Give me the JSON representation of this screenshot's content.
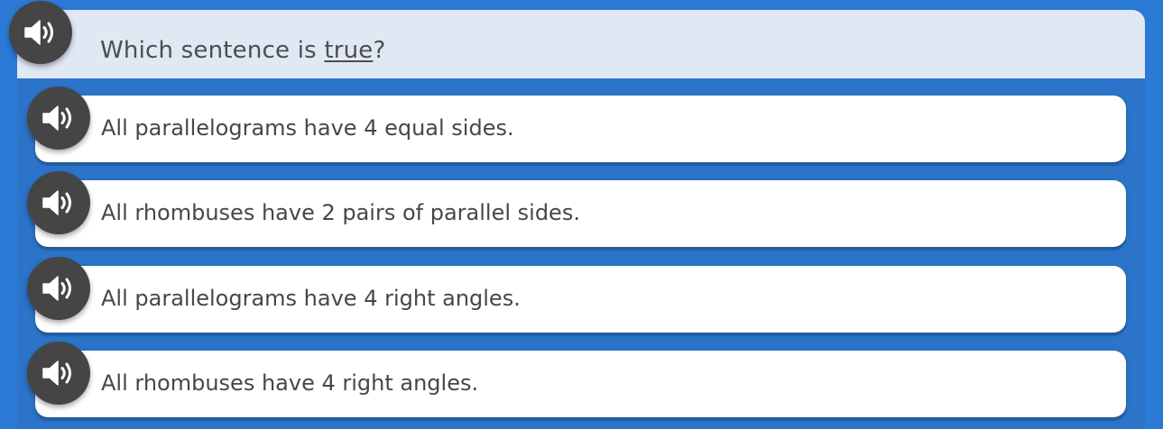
{
  "question": {
    "prefix": "Which sentence is ",
    "emphasis": "true",
    "suffix": "?",
    "speaker_icon": "speaker-icon"
  },
  "answers": [
    {
      "label": "All parallelograms have 4 equal sides.",
      "speaker_icon": "speaker-icon"
    },
    {
      "label": "All rhombuses have 2 pairs of parallel sides.",
      "speaker_icon": "speaker-icon"
    },
    {
      "label": "All parallelograms have 4 right angles.",
      "speaker_icon": "speaker-icon"
    },
    {
      "label": "All rhombuses have 4 right angles.",
      "speaker_icon": "speaker-icon"
    }
  ],
  "colors": {
    "background": "#2a7ad6",
    "panel": "#2b74c9",
    "question_bar": "#e0e8f3",
    "speaker_button": "#454545",
    "answer_card": "#ffffff",
    "text": "#474747"
  }
}
